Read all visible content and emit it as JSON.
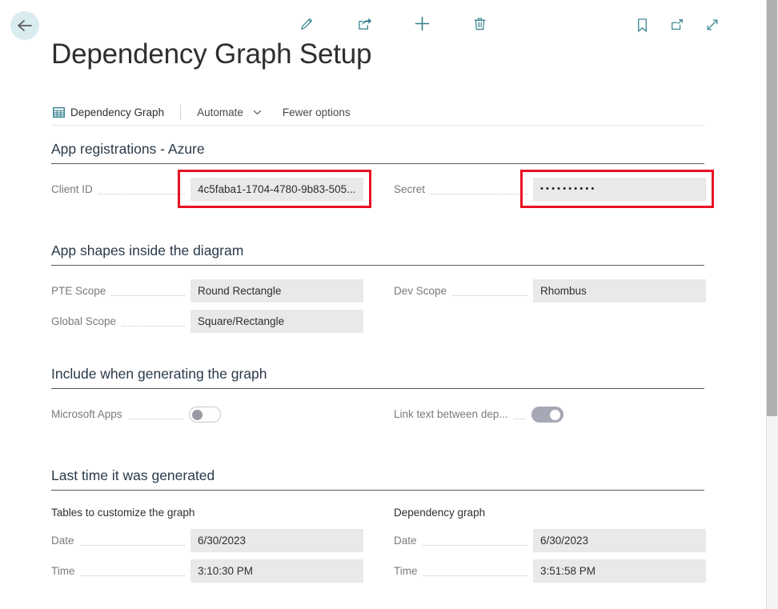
{
  "header": {
    "back_icon": "arrow-left-icon",
    "title": "Dependency Graph Setup",
    "center_tools": [
      {
        "name": "edit-icon",
        "label": "Edit"
      },
      {
        "name": "share-icon",
        "label": "Share"
      },
      {
        "name": "plus-icon",
        "label": "New"
      },
      {
        "name": "trash-icon",
        "label": "Delete"
      }
    ],
    "right_tools": [
      {
        "name": "bookmark-icon",
        "label": "Bookmark"
      },
      {
        "name": "open-in-new-icon",
        "label": "Open in new window"
      },
      {
        "name": "expand-icon",
        "label": "Expand"
      }
    ]
  },
  "actionbar": {
    "grid_icon": "table-grid-icon",
    "dependency_graph": "Dependency Graph",
    "automate": "Automate",
    "automate_chevron": "chevron-down-icon",
    "fewer_options": "Fewer options"
  },
  "sections": {
    "app_registrations": {
      "heading": "App registrations - Azure",
      "client_id": {
        "label": "Client ID",
        "value": "4c5faba1-1704-4780-9b83-505...",
        "highlighted": true
      },
      "secret": {
        "label": "Secret",
        "value": "••••••••••",
        "masked": true,
        "highlighted": true
      }
    },
    "app_shapes": {
      "heading": "App shapes inside the diagram",
      "pte_scope": {
        "label": "PTE Scope",
        "value": "Round Rectangle"
      },
      "dev_scope": {
        "label": "Dev Scope",
        "value": "Rhombus"
      },
      "global_scope": {
        "label": "Global Scope",
        "value": "Square/Rectangle"
      }
    },
    "include": {
      "heading": "Include when generating the graph",
      "microsoft_apps": {
        "label": "Microsoft Apps",
        "state": "off"
      },
      "link_text": {
        "label": "Link text between dep...",
        "state": "on"
      }
    },
    "last_generated": {
      "heading": "Last time it was generated",
      "left": {
        "subheading": "Tables to customize the graph",
        "date": {
          "label": "Date",
          "value": "6/30/2023"
        },
        "time": {
          "label": "Time",
          "value": "3:10:30 PM"
        }
      },
      "right": {
        "subheading": "Dependency graph",
        "date": {
          "label": "Date",
          "value": "6/30/2023"
        },
        "time": {
          "label": "Time",
          "value": "3:51:58 PM"
        }
      }
    }
  },
  "colors": {
    "accent_teal": "#2e7d8a",
    "highlight_red": "#e81123",
    "input_bg": "#e9e9e9",
    "heading": "#2b3a4a"
  }
}
